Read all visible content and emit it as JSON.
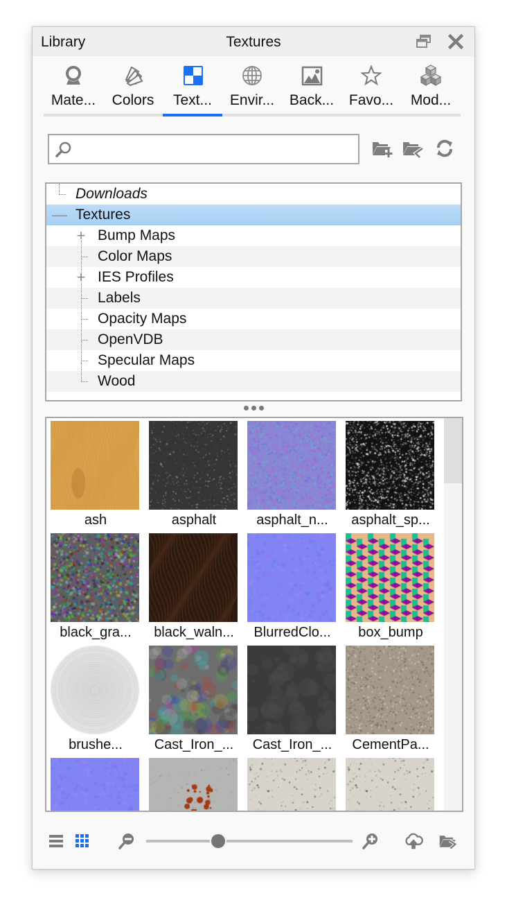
{
  "window": {
    "title_left": "Library",
    "title_center": "Textures",
    "restore_icon": "restore-window-icon",
    "close_icon": "close-icon"
  },
  "tabs": [
    {
      "label": "Mate...",
      "full": "Materials",
      "icon": "material-sphere-icon",
      "active": false
    },
    {
      "label": "Colors",
      "full": "Colors",
      "icon": "color-swatches-icon",
      "active": false
    },
    {
      "label": "Text...",
      "full": "Textures",
      "icon": "checker-texture-icon",
      "active": true
    },
    {
      "label": "Envir...",
      "full": "Environments",
      "icon": "globe-icon",
      "active": false
    },
    {
      "label": "Back...",
      "full": "Backplates",
      "icon": "image-icon",
      "active": false
    },
    {
      "label": "Favo...",
      "full": "Favorites",
      "icon": "star-icon",
      "active": false
    },
    {
      "label": "Mod...",
      "full": "Models",
      "icon": "cubes-icon",
      "active": false
    }
  ],
  "accent_color": "#1a6ef5",
  "search": {
    "value": "",
    "placeholder": ""
  },
  "actions": [
    {
      "name": "add-folder-button",
      "icon": "folder-add-icon"
    },
    {
      "name": "import-folder-button",
      "icon": "folder-import-icon"
    },
    {
      "name": "refresh-button",
      "icon": "refresh-icon"
    }
  ],
  "tree": [
    {
      "label": "Downloads",
      "level": 0,
      "expander": "none",
      "italic": true,
      "selected": false
    },
    {
      "label": "Textures",
      "level": 0,
      "expander": "collapse",
      "italic": false,
      "selected": true
    },
    {
      "label": "Bump Maps",
      "level": 1,
      "expander": "expand",
      "italic": false,
      "selected": false
    },
    {
      "label": "Color Maps",
      "level": 1,
      "expander": "none",
      "italic": false,
      "selected": false
    },
    {
      "label": "IES Profiles",
      "level": 1,
      "expander": "expand",
      "italic": false,
      "selected": false
    },
    {
      "label": "Labels",
      "level": 1,
      "expander": "none",
      "italic": false,
      "selected": false
    },
    {
      "label": "Opacity Maps",
      "level": 1,
      "expander": "none",
      "italic": false,
      "selected": false
    },
    {
      "label": "OpenVDB",
      "level": 1,
      "expander": "none",
      "italic": false,
      "selected": false
    },
    {
      "label": "Specular Maps",
      "level": 1,
      "expander": "none",
      "italic": false,
      "selected": false
    },
    {
      "label": "Wood",
      "level": 1,
      "expander": "none",
      "italic": false,
      "selected": false
    }
  ],
  "textures": [
    {
      "label": "ash",
      "kind": "wood-light"
    },
    {
      "label": "asphalt",
      "kind": "asphalt"
    },
    {
      "label": "asphalt_n...",
      "kind": "normal-noisy"
    },
    {
      "label": "asphalt_sp...",
      "kind": "speckle-bw"
    },
    {
      "label": "black_gra...",
      "kind": "granite"
    },
    {
      "label": "black_waln...",
      "kind": "wood-dark"
    },
    {
      "label": "BlurredClo...",
      "kind": "normal-smooth"
    },
    {
      "label": "box_bump",
      "kind": "cubes-pattern"
    },
    {
      "label": "brushe...",
      "kind": "brushed-disc"
    },
    {
      "label": "Cast_Iron_...",
      "kind": "cast-iron-light"
    },
    {
      "label": "Cast_Iron_...",
      "kind": "cast-iron-dark"
    },
    {
      "label": "CementPa...",
      "kind": "cement"
    },
    {
      "label": "",
      "kind": "normal-smooth"
    },
    {
      "label": "",
      "kind": "concrete-rust"
    },
    {
      "label": "",
      "kind": "concrete-light"
    },
    {
      "label": "",
      "kind": "concrete-light"
    }
  ],
  "bottom": {
    "list_view_icon": "list-view-icon",
    "grid_view_icon": "grid-view-icon",
    "zoom_out_icon": "zoom-out-icon",
    "zoom_in_icon": "zoom-in-icon",
    "upload_icon": "cloud-upload-icon",
    "export_icon": "folder-export-icon",
    "thumbnail_size_fraction": 0.35,
    "active_view": "grid"
  }
}
